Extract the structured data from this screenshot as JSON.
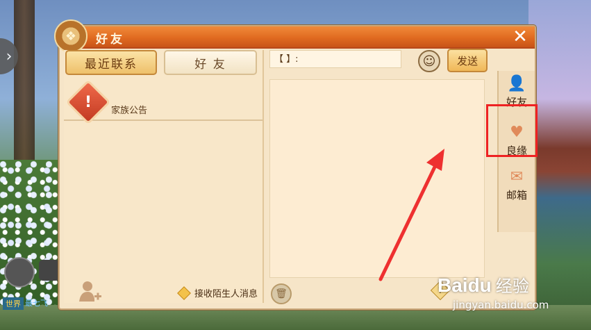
{
  "window": {
    "title": "好友",
    "close_glyph": "✕"
  },
  "left_panel": {
    "tabs": [
      {
        "label": "最近联系",
        "active": true
      },
      {
        "label": "好 友",
        "active": false
      }
    ],
    "notice": {
      "label": "家族公告",
      "icon": "alert-icon"
    },
    "stranger_label": "接收陌生人消息"
  },
  "right_panel": {
    "input_value": "【 】:",
    "send_label": "发送",
    "help_glyph": "?"
  },
  "sidebar": {
    "items": [
      {
        "label": "好友",
        "icon": "friends-icon"
      },
      {
        "label": "良缘",
        "icon": "heart-icon"
      },
      {
        "label": "邮箱",
        "icon": "mail-icon"
      }
    ]
  },
  "hud": {
    "world_tag": "世界",
    "world_msg": "最七飞"
  },
  "watermark": {
    "logo": "Baidu",
    "cn": "经验",
    "url": "jingyan.baidu.com"
  },
  "colors": {
    "title_bar": "#e06a20",
    "panel_bg": "#f6e5c8",
    "highlight": "#ee2222"
  }
}
